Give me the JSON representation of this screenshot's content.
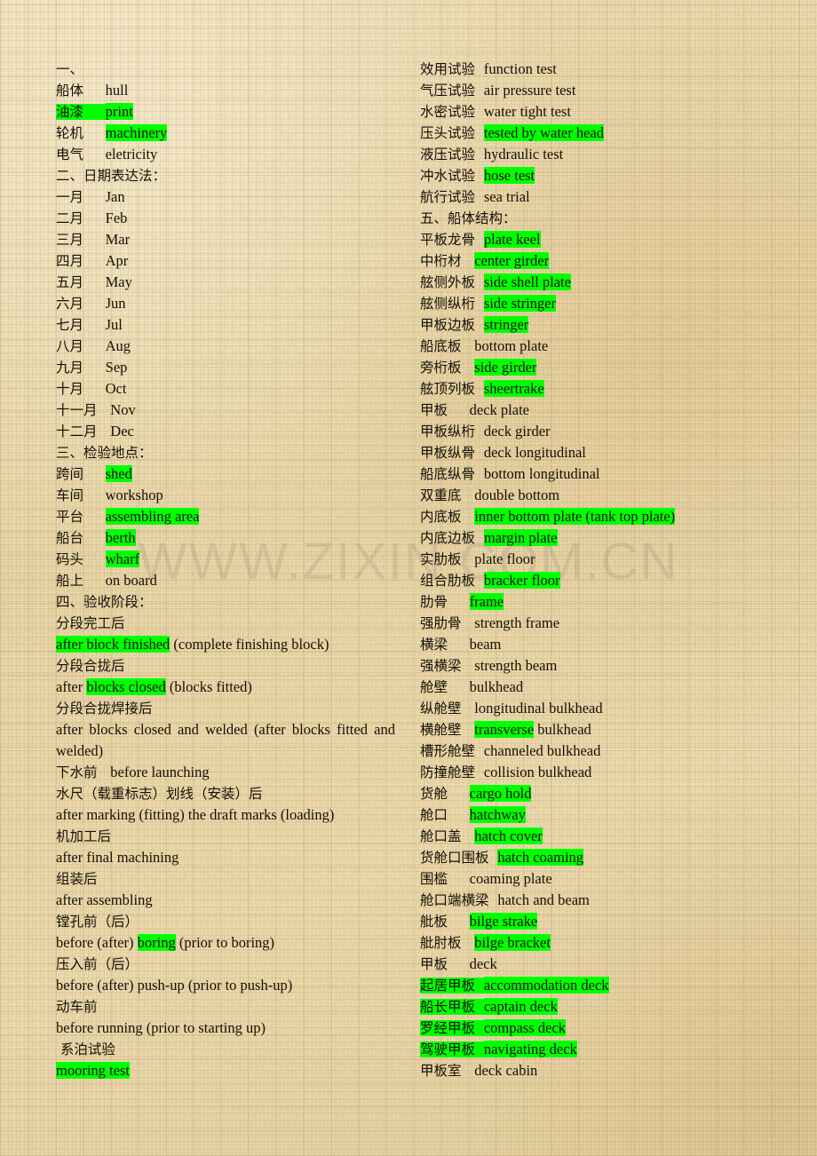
{
  "page": {
    "background_color": "#e9d8ad",
    "highlight_color": "#00ff00",
    "text_color": "#141008",
    "watermark": "WWW.ZIXIN.COM.CN"
  },
  "left_column": [
    {
      "cn": "一、",
      "en": "",
      "hl": "none"
    },
    {
      "cn": "船体",
      "en": "hull",
      "hl": "none"
    },
    {
      "cn": "油漆",
      "en": "print",
      "hl": "both"
    },
    {
      "cn": "轮机",
      "en": "machinery",
      "hl": "en"
    },
    {
      "cn": "电气",
      "en": "eletricity",
      "hl": "none"
    },
    {
      "cn": "二、日期表达法：",
      "en": "",
      "hl": "none"
    },
    {
      "cn": "一月",
      "en": "Jan",
      "hl": "none"
    },
    {
      "cn": "二月",
      "en": "Feb",
      "hl": "none"
    },
    {
      "cn": "三月",
      "en": "Mar",
      "hl": "none"
    },
    {
      "cn": "四月",
      "en": "Apr",
      "hl": "none"
    },
    {
      "cn": "五月",
      "en": "May",
      "hl": "none"
    },
    {
      "cn": "六月",
      "en": "Jun",
      "hl": "none"
    },
    {
      "cn": "七月",
      "en": "Jul",
      "hl": "none"
    },
    {
      "cn": "八月",
      "en": "Aug",
      "hl": "none"
    },
    {
      "cn": "九月",
      "en": "Sep",
      "hl": "none"
    },
    {
      "cn": "十月",
      "en": "Oct",
      "hl": "none"
    },
    {
      "cn": "十一月",
      "en": "Nov",
      "hl": "none"
    },
    {
      "cn": "十二月",
      "en": "Dec",
      "hl": "none"
    },
    {
      "cn": "三、检验地点：",
      "en": "",
      "hl": "none"
    },
    {
      "cn": "跨间",
      "en": "shed",
      "hl": "en"
    },
    {
      "cn": "车间",
      "en": "workshop",
      "hl": "none"
    },
    {
      "cn": "平台",
      "en": "assembling area",
      "hl": "en"
    },
    {
      "cn": "船台",
      "en": "berth",
      "hl": "en"
    },
    {
      "cn": "码头",
      "en": "wharf",
      "hl": "en"
    },
    {
      "cn": "船上",
      "en": "on board",
      "hl": "none"
    },
    {
      "cn": "四、验收阶段：",
      "en": "",
      "hl": "none"
    },
    {
      "cn": "分段完工后",
      "en": "",
      "hl": "none"
    },
    {
      "cn": "",
      "en": "after block finished (complete finishing block)",
      "hl": "partial",
      "hl_text": "after block finished",
      "tail": " (complete finishing block)"
    },
    {
      "cn": "分段合拢后",
      "en": "",
      "hl": "none"
    },
    {
      "cn": "",
      "en": "after blocks closed (blocks fitted)",
      "hl": "partial",
      "lead": "after ",
      "hl_text": "blocks closed",
      "tail": " (blocks fitted)"
    },
    {
      "cn": "分段合拢焊接后",
      "en": "",
      "hl": "none"
    },
    {
      "cn": "",
      "en": "after blocks closed and welded (after blocks fitted and welded)",
      "hl": "none",
      "wrap": true
    },
    {
      "cn": "下水前",
      "en": "before launching",
      "hl": "none"
    },
    {
      "cn": "水尺（载重标志）划线（安装）后",
      "en": "",
      "hl": "none"
    },
    {
      "cn": "",
      "en": "after marking (fitting) the draft marks (loading)",
      "hl": "none"
    },
    {
      "cn": "机加工后",
      "en": "",
      "hl": "none"
    },
    {
      "cn": "",
      "en": "after final machining",
      "hl": "none"
    },
    {
      "cn": "组装后",
      "en": "",
      "hl": "none"
    },
    {
      "cn": "",
      "en": "after assembling",
      "hl": "none"
    },
    {
      "cn": "镗孔前（后）",
      "en": "",
      "hl": "none"
    },
    {
      "cn": "",
      "en": "before (after) boring (prior to boring)",
      "hl": "partial",
      "lead": "before (after) ",
      "hl_text": "boring",
      "tail": " (prior to boring)"
    },
    {
      "cn": "压入前（后）",
      "en": "",
      "hl": "none"
    },
    {
      "cn": "",
      "en": "before (after) push-up (prior to push-up)",
      "hl": "none"
    },
    {
      "cn": "动车前",
      "en": "",
      "hl": "none"
    },
    {
      "cn": "",
      "en": "before running (prior to starting up)",
      "hl": "none"
    },
    {
      "cn": " 系泊试验",
      "en": "",
      "hl": "none"
    },
    {
      "cn": "",
      "en": "mooring test",
      "hl": "en"
    }
  ],
  "right_column": [
    {
      "cn": "效用试验",
      "en": "function test",
      "hl": "none"
    },
    {
      "cn": "气压试验",
      "en": "air pressure test",
      "hl": "none"
    },
    {
      "cn": "水密试验",
      "en": "water tight test",
      "hl": "none"
    },
    {
      "cn": "压头试验",
      "en": "tested by water head",
      "hl": "en"
    },
    {
      "cn": "液压试验",
      "en": "hydraulic test",
      "hl": "none"
    },
    {
      "cn": "冲水试验",
      "en": "hose test",
      "hl": "en"
    },
    {
      "cn": "航行试验",
      "en": "sea trial",
      "hl": "none"
    },
    {
      "cn": "五、船体结构：",
      "en": "",
      "hl": "none"
    },
    {
      "cn": "平板龙骨",
      "en": "plate keel",
      "hl": "en"
    },
    {
      "cn": "中桁材",
      "en": "center girder",
      "hl": "en"
    },
    {
      "cn": "舷侧外板",
      "en": "side shell plate",
      "hl": "en"
    },
    {
      "cn": "舷侧纵桁",
      "en": "side stringer",
      "hl": "en"
    },
    {
      "cn": "甲板边板",
      "en": "stringer",
      "hl": "en"
    },
    {
      "cn": "船底板",
      "en": "bottom plate",
      "hl": "none"
    },
    {
      "cn": "旁桁板",
      "en": "side girder",
      "hl": "en"
    },
    {
      "cn": "舷顶列板",
      "en": "sheertrake",
      "hl": "en"
    },
    {
      "cn": "甲板",
      "en": "deck plate",
      "hl": "none"
    },
    {
      "cn": "甲板纵桁",
      "en": "deck girder",
      "hl": "none"
    },
    {
      "cn": "甲板纵骨",
      "en": "deck longitudinal",
      "hl": "none"
    },
    {
      "cn": "船底纵骨",
      "en": "bottom longitudinal",
      "hl": "none"
    },
    {
      "cn": "双重底",
      "en": "double bottom",
      "hl": "none"
    },
    {
      "cn": "内底板",
      "en": "inner bottom plate (tank top plate)",
      "hl": "en"
    },
    {
      "cn": "内底边板",
      "en": "margin plate",
      "hl": "en"
    },
    {
      "cn": "实肋板",
      "en": "plate floor",
      "hl": "none"
    },
    {
      "cn": "组合肋板",
      "en": "bracker floor",
      "hl": "en"
    },
    {
      "cn": "肋骨",
      "en": "frame",
      "hl": "en"
    },
    {
      "cn": "强肋骨",
      "en": "strength frame",
      "hl": "none"
    },
    {
      "cn": "横梁",
      "en": "beam",
      "hl": "none"
    },
    {
      "cn": "强横梁",
      "en": "strength beam",
      "hl": "none"
    },
    {
      "cn": "舱壁",
      "en": "bulkhead",
      "hl": "none"
    },
    {
      "cn": "纵舱壁",
      "en": "longitudinal bulkhead",
      "hl": "none"
    },
    {
      "cn": "横舱壁",
      "en": "transverse bulkhead",
      "hl": "partial",
      "hl_text": "transverse",
      "tail": " bulkhead"
    },
    {
      "cn": "槽形舱壁",
      "en": "channeled bulkhead",
      "hl": "none"
    },
    {
      "cn": "防撞舱壁",
      "en": "collision bulkhead",
      "hl": "none"
    },
    {
      "cn": "货舱",
      "en": "cargo hold",
      "hl": "en"
    },
    {
      "cn": "舱口",
      "en": "hatchway",
      "hl": "en"
    },
    {
      "cn": "舱口盖",
      "en": "hatch cover",
      "hl": "en"
    },
    {
      "cn": "货舱口围板",
      "en": "hatch coaming",
      "hl": "en"
    },
    {
      "cn": "围槛",
      "en": "coaming plate",
      "hl": "none"
    },
    {
      "cn": "舱口端横梁",
      "en": "hatch and beam",
      "hl": "none"
    },
    {
      "cn": "舭板",
      "en": "bilge strake",
      "hl": "en"
    },
    {
      "cn": "舭肘板",
      "en": "bilge bracket",
      "hl": "en"
    },
    {
      "cn": "甲板",
      "en": "deck",
      "hl": "none"
    },
    {
      "cn": "起居甲板",
      "en": "accommodation deck",
      "hl": "both"
    },
    {
      "cn": "船长甲板",
      "en": "captain deck",
      "hl": "both"
    },
    {
      "cn": "罗经甲板",
      "en": "compass deck",
      "hl": "both"
    },
    {
      "cn": "驾驶甲板",
      "en": "navigating deck",
      "hl": "both"
    },
    {
      "cn": "甲板室",
      "en": "deck cabin",
      "hl": "none"
    }
  ]
}
